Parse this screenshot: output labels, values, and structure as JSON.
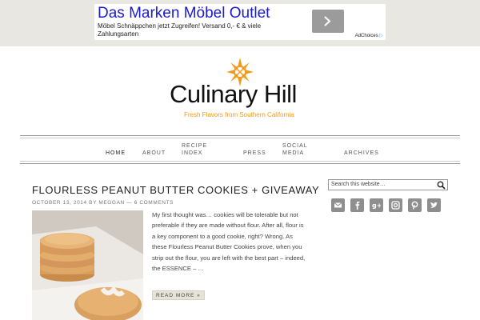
{
  "ad": {
    "title": "Das Marken Möbel Outlet",
    "description": "Möbel Schnäppchen jetzt Zugreifen! Versand 0,- € & viele Zahlungsarten",
    "adchoices_label": "AdChoices"
  },
  "site": {
    "name": "Culinary Hill",
    "tagline": "Fresh Flavors from Southern California"
  },
  "nav": {
    "items": [
      {
        "label": "Home"
      },
      {
        "label": "About"
      },
      {
        "label": "Recipe Index"
      },
      {
        "label": "Press"
      },
      {
        "label": "Social Media"
      },
      {
        "label": "Archives"
      }
    ]
  },
  "post": {
    "title": "Flourless Peanut Butter Cookies + Giveaway",
    "date": "October 13, 2014",
    "by": "by",
    "author": "Meggan",
    "separator": "—",
    "comments": "6 Comments",
    "excerpt": "My first thought was… cookies will be tolerable but not preferable if they are made without flour. After all, flour is a key component to a good cookie, right? Wrong. As these Flourless Peanut Butter Cookies prove, when you strip out the flour, you are left with the best part – indeed, the ESSENCE – …",
    "read_more": "Read More »"
  },
  "sidebar": {
    "search_placeholder": "Search this website…",
    "social_icons": [
      "email-icon",
      "facebook-icon",
      "google-plus-icon",
      "instagram-icon",
      "pinterest-icon",
      "twitter-icon"
    ]
  },
  "colors": {
    "accent": "#f29a1c",
    "ad_title": "#1a1ad6",
    "social_bg": "#8e8e8e"
  }
}
